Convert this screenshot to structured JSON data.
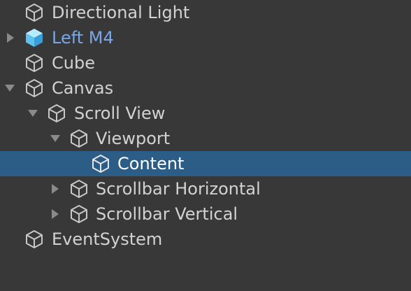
{
  "hierarchy": {
    "items": [
      {
        "label": "Directional Light",
        "icon": "gameobject-cube-icon",
        "expander": "none"
      },
      {
        "label": "Left M4",
        "icon": "prefab-cube-icon",
        "expander": "collapsed",
        "prefab": true
      },
      {
        "label": "Cube",
        "icon": "gameobject-cube-icon",
        "expander": "none"
      },
      {
        "label": "Canvas",
        "icon": "gameobject-cube-icon",
        "expander": "expanded"
      },
      {
        "label": "Scroll View",
        "icon": "gameobject-cube-icon",
        "expander": "expanded"
      },
      {
        "label": "Viewport",
        "icon": "gameobject-cube-icon",
        "expander": "expanded"
      },
      {
        "label": "Content",
        "icon": "gameobject-cube-icon",
        "expander": "none",
        "selected": true
      },
      {
        "label": "Scrollbar Horizontal",
        "icon": "gameobject-cube-icon",
        "expander": "collapsed"
      },
      {
        "label": "Scrollbar Vertical",
        "icon": "gameobject-cube-icon",
        "expander": "collapsed"
      },
      {
        "label": "EventSystem",
        "icon": "gameobject-cube-icon",
        "expander": "none"
      }
    ]
  },
  "colors": {
    "background": "#383838",
    "selection": "#2c5d87",
    "text": "#d2d2d2",
    "prefab_text": "#7aa7e8",
    "selected_text": "#ffffff"
  }
}
